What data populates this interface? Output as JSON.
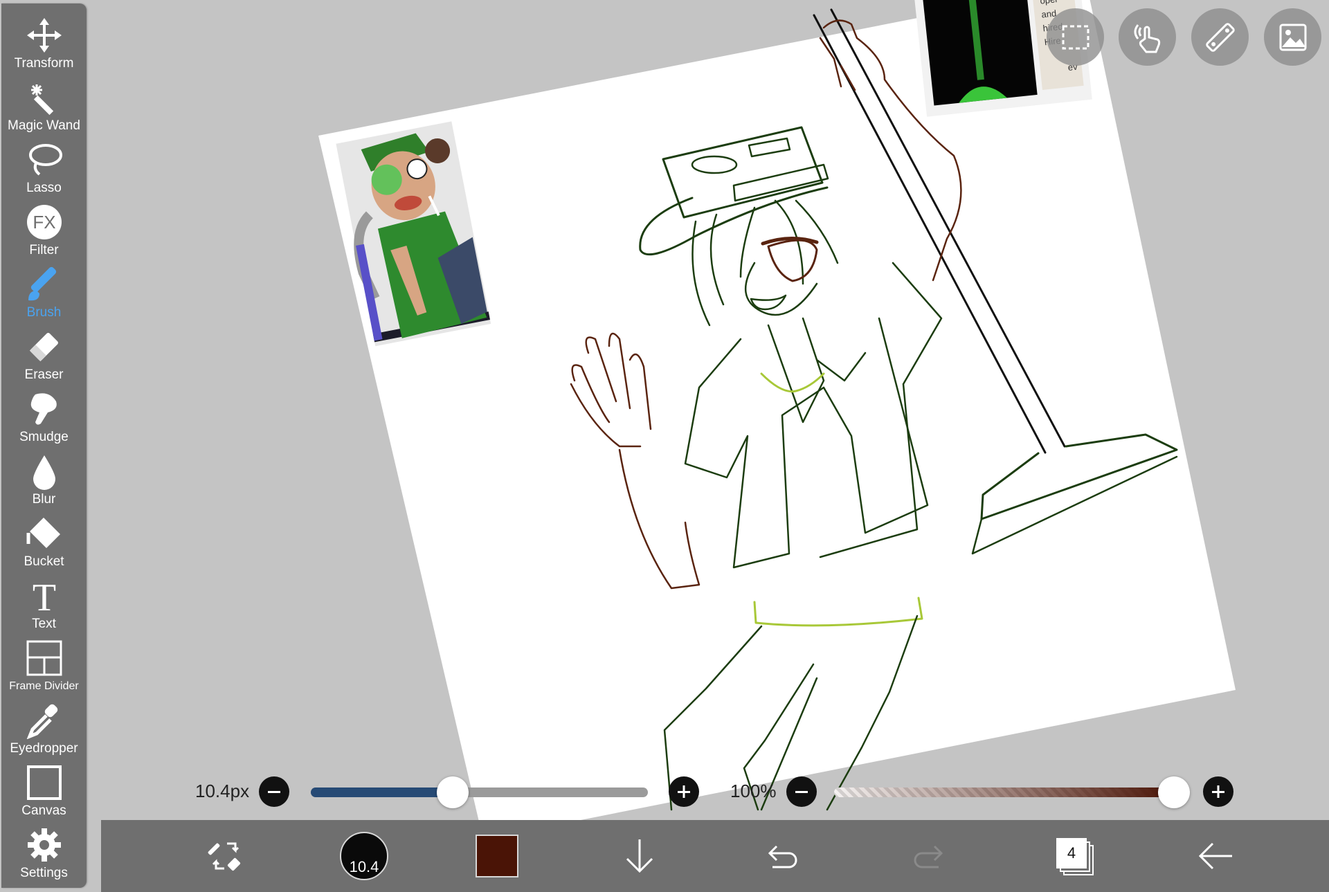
{
  "app": {
    "tools": [
      {
        "label": "Transform",
        "icon": "transform-icon"
      },
      {
        "label": "Magic Wand",
        "icon": "magic-wand-icon"
      },
      {
        "label": "Lasso",
        "icon": "lasso-icon"
      },
      {
        "label": "Filter",
        "icon": "fx-filter-icon",
        "icon_text": "FX"
      },
      {
        "label": "Brush",
        "icon": "brush-icon",
        "active": true
      },
      {
        "label": "Eraser",
        "icon": "eraser-icon"
      },
      {
        "label": "Smudge",
        "icon": "smudge-icon"
      },
      {
        "label": "Blur",
        "icon": "blur-drop-icon"
      },
      {
        "label": "Bucket",
        "icon": "bucket-icon"
      },
      {
        "label": "Text",
        "icon": "text-icon",
        "icon_text": "T"
      },
      {
        "label": "Frame Divider",
        "icon": "frame-divider-icon"
      },
      {
        "label": "Eyedropper",
        "icon": "eyedropper-icon"
      },
      {
        "label": "Canvas",
        "icon": "canvas-icon"
      },
      {
        "label": "Settings",
        "icon": "gear-icon"
      }
    ],
    "top_buttons": [
      "selection-icon",
      "touch-gesture-icon",
      "ruler-icon",
      "material-image-icon"
    ]
  },
  "sliders": {
    "brush_size": {
      "label": "10.4px",
      "value_fraction": 0.42
    },
    "opacity": {
      "label": "100%",
      "value_fraction": 1.0
    }
  },
  "bottom_bar": {
    "brush_size_display": "10.4",
    "current_color": "#4a1406",
    "layer_count": "4",
    "icons": [
      "brush-eraser-swap-icon",
      "brush-size-indicator",
      "color-swatch",
      "arrow-down-icon",
      "undo-icon",
      "redo-icon",
      "layers-icon",
      "back-arrow-icon"
    ]
  },
  "colors": {
    "toolbar_bg": "#6f6f6f",
    "workspace_bg": "#c4c4c4",
    "accent_active": "#4aa3f0",
    "size_track": "#264a75",
    "line_dark_green": "#1c3d10",
    "line_brown": "#5a2410",
    "line_lime": "#a8c838"
  }
}
